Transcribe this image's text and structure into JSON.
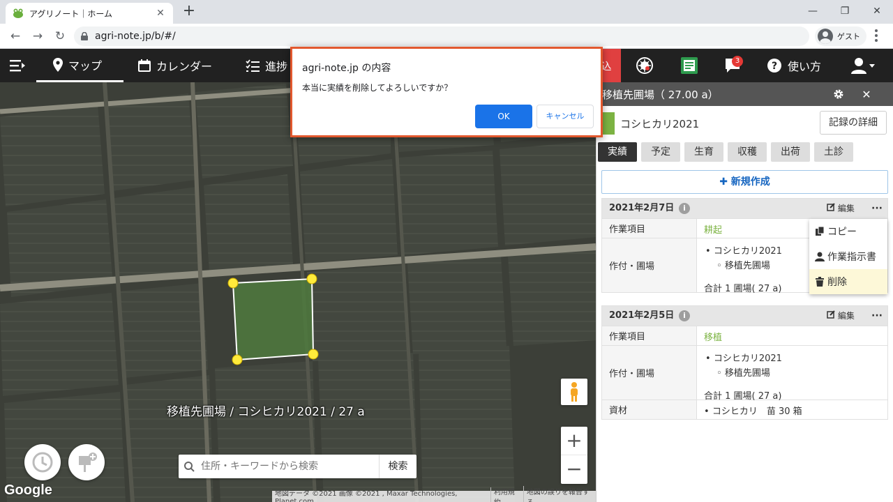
{
  "browser": {
    "tab_title": "アグリノート｜ホーム",
    "url": "agri-note.jp/b/#/",
    "profile_label": "ゲスト"
  },
  "nav": {
    "items": [
      {
        "label": "マップ",
        "icon": "map-pin-icon"
      },
      {
        "label": "カレンダー",
        "icon": "calendar-icon"
      },
      {
        "label": "進捗",
        "icon": "list-icon"
      }
    ],
    "red_label": "込",
    "notification_count": "3",
    "help_label": "使い方"
  },
  "dialog": {
    "title": "agri-note.jp の内容",
    "message": "本当に実績を削除してよろしいですか？",
    "ok": "OK",
    "cancel": "キャンセル"
  },
  "map": {
    "field_label": "移植先圃場 / コシヒカリ2021 / 27 a",
    "search_placeholder": "住所・キーワードから検索",
    "search_button": "検索",
    "google": "Google",
    "attribution": [
      "地図データ ©2021 画像 ©2021 , Maxar Technologies, Planet.com",
      "利用規約",
      "地図の誤りを報告する"
    ]
  },
  "panel": {
    "header": "移植先圃場（ 27.00 a）",
    "crop_name": "コシヒカリ2021",
    "detail_button": "記録の詳細",
    "tabs": [
      "実績",
      "予定",
      "生育",
      "収穫",
      "出荷",
      "土診"
    ],
    "new_button": "新規作成",
    "edit_label": "編集",
    "more_label": "···",
    "records": [
      {
        "date": "2021年2月7日",
        "work_label": "作業項目",
        "work_value": "耕起",
        "field_label": "作付・圃場",
        "crop": "コシヒカリ2021",
        "field": "移植先圃場",
        "total": "合計 1 圃場( 27 a)"
      },
      {
        "date": "2021年2月5日",
        "work_label": "作業項目",
        "work_value": "移植",
        "field_label": "作付・圃場",
        "crop": "コシヒカリ2021",
        "field": "移植先圃場",
        "total": "合計 1 圃場( 27 a)",
        "material_label": "資材",
        "material_value": "コシヒカリ　苗 30 箱"
      }
    ],
    "popup": [
      "コピー",
      "作業指示書",
      "削除"
    ]
  },
  "colors": {
    "accent": "#1a73e8",
    "crop": "#7cb342",
    "dialog_border": "#e2582e"
  }
}
